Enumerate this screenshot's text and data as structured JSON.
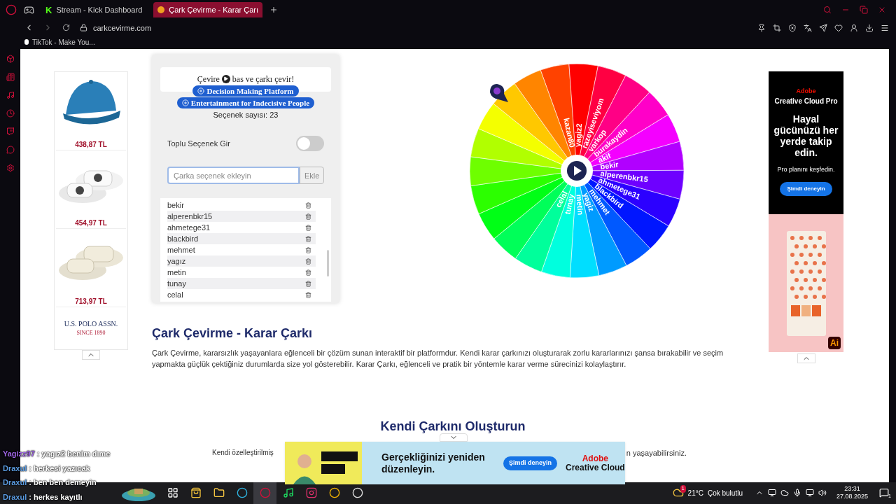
{
  "browser": {
    "tabs": [
      {
        "label": "Stream - Kick Dashboard",
        "favicon": "K",
        "selected": false
      },
      {
        "label": "Çark Çevirme - Karar Çarı",
        "selected": true
      }
    ],
    "address": "carkcevirme.com",
    "bookmarks": [
      "TikTok - Make You..."
    ]
  },
  "products": [
    {
      "kind": "cap",
      "price": "438,87 TL"
    },
    {
      "kind": "slide",
      "price": "454,97 TL"
    },
    {
      "kind": "sandal",
      "price": "713,97 TL"
    }
  ],
  "brand": {
    "name": "U.S. POLO ASSN.",
    "tagline": "SINCE 1890"
  },
  "panel": {
    "hint_before": "Çevire",
    "hint_after": "bas ve çarkı çevir!",
    "pills": [
      "Decision Making Platform",
      "Entertainment for Indecisive People"
    ],
    "count": "Seçenek sayısı: 23",
    "bulk_label": "Toplu Seçenek Gir",
    "bulk_on": false,
    "input_placeholder": "Çarka seçenek ekleyin",
    "add_button": "Ekle",
    "options": [
      "bekir",
      "alperenbkr15",
      "ahmetege31",
      "blackbird",
      "mehmet",
      "yagız",
      "metin",
      "tunay",
      "celal"
    ]
  },
  "wheel": {
    "segments": [
      {
        "label": "kazan80",
        "color": "#ff4200"
      },
      {
        "label": "yagiz2",
        "color": "#ff0000"
      },
      {
        "label": "razeyiseviyom",
        "color": "#ff0042"
      },
      {
        "label": "varkop",
        "color": "#ff0085"
      },
      {
        "label": "burakaydin",
        "color": "#ff00c8"
      },
      {
        "label": "akif",
        "color": "#f400ff"
      },
      {
        "label": "bekir",
        "color": "#b100ff"
      },
      {
        "label": "alperenbkr15",
        "color": "#6e00ff"
      },
      {
        "label": "ahmetege31",
        "color": "#2c00ff"
      },
      {
        "label": "blackbird",
        "color": "#0016ff"
      },
      {
        "label": "mehmet",
        "color": "#0059ff"
      },
      {
        "label": "yagiz",
        "color": "#009bff"
      },
      {
        "label": "metin",
        "color": "#00deff"
      },
      {
        "label": "tunay",
        "color": "#00ffde"
      },
      {
        "label": "celal",
        "color": "#00ff9b"
      },
      {
        "color": "#00ff59"
      },
      {
        "color": "#00ff16"
      },
      {
        "color": "#2cff00"
      },
      {
        "color": "#6eff00"
      },
      {
        "color": "#b1ff00"
      },
      {
        "color": "#f4ff00"
      },
      {
        "color": "#ffc800"
      },
      {
        "color": "#ff8500"
      }
    ]
  },
  "article": {
    "title": "Çark Çevirme - Karar Çarkı",
    "body": "Çark Çevirme, kararsızlık yaşayanlara eğlenceli bir çözüm sunan interaktif bir platformdur. Kendi karar çarkınızı oluşturarak zorlu kararlarınızı şansa bırakabilir ve seçim yapmakta güçlük çektiğiniz durumlarda size yol gösterebilir. Karar Çarkı, eğlenceli ve pratik bir yöntemle karar verme sürecinizi kolaylaştırır.",
    "section_title": "Kendi Çarkını Oluşturun",
    "section_left": "Kendi özelleştirilmiş",
    "section_right": "n yaşayabilirsiniz."
  },
  "side_ad": {
    "brand": "Adobe",
    "product": "Creative Cloud Pro",
    "headline": "Hayal gücünüzü her yerde takip edin.",
    "sub": "Pro planını keşfedin.",
    "button": "Şimdi deneyin",
    "badge": "Ai"
  },
  "bottom_ad": {
    "headline": "Gerçekliğinizi yeniden düzenleyin.",
    "button": "Şimdi deneyin",
    "brand": "Adobe",
    "product": "Creative Cloud"
  },
  "chat": [
    {
      "user": "Yagizz97",
      "color": "#a066e8",
      "text": ": yagız2 benim dıme"
    },
    {
      "user": "Draxul",
      "color": "#5b9be0",
      "text": ": herkesi yazıcak"
    },
    {
      "user": "Draxul",
      "color": "#5b9be0",
      "text": ": ben ben demeyin"
    },
    {
      "user": "Draxul",
      "color": "#5b9be0",
      "text": ": herkes kayıtlı"
    }
  ],
  "taskbar": {
    "apps": [
      {
        "kind": "taskview",
        "selected": false
      },
      {
        "kind": "store",
        "selected": false
      },
      {
        "kind": "folder",
        "selected": false
      },
      {
        "kind": "edge",
        "selected": false
      },
      {
        "kind": "opera",
        "selected": true
      },
      {
        "kind": "spotify",
        "selected": false
      },
      {
        "kind": "instagram",
        "selected": false
      },
      {
        "kind": "chrome",
        "selected": false
      },
      {
        "kind": "obs",
        "selected": false
      }
    ],
    "temp": "21°C",
    "weather": "Çok bulutlu",
    "weather_badge": "1",
    "time": "23:31",
    "date": "27.08.2025",
    "notifications": "1"
  }
}
